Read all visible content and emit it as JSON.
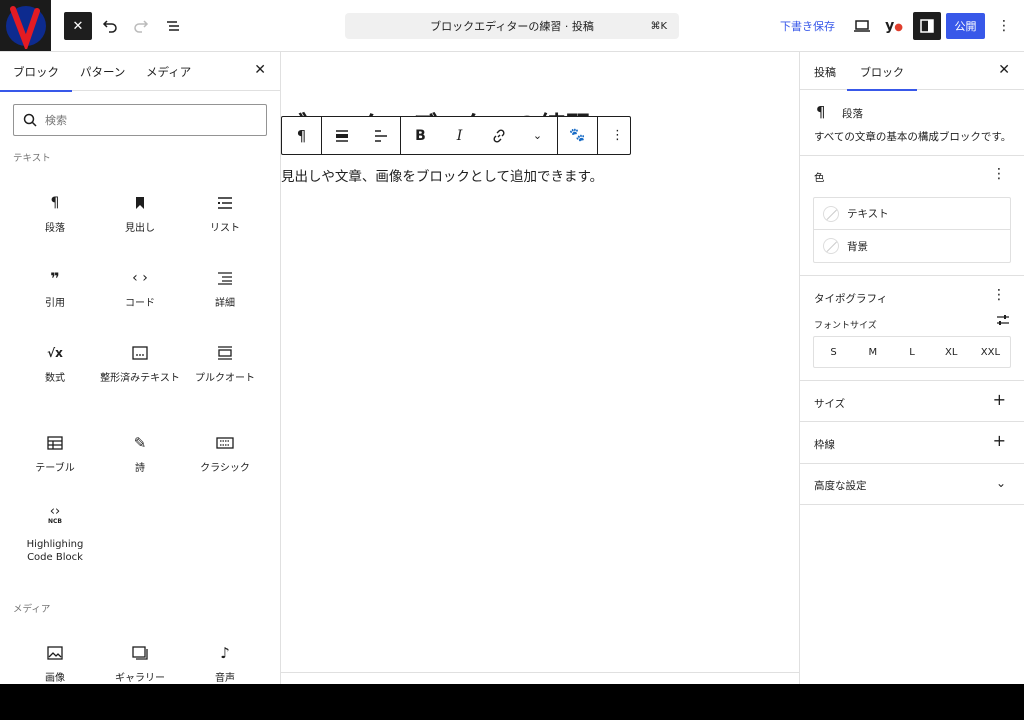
{
  "header": {
    "command_title": "ブロックエディターの練習 · 投稿",
    "command_shortcut": "⌘K",
    "save_draft": "下書き保存",
    "publish": "公開",
    "accent_color": "#3858e9"
  },
  "inserter": {
    "tabs": [
      {
        "label": "ブロック",
        "active": true
      },
      {
        "label": "パターン",
        "active": false
      },
      {
        "label": "メディア",
        "active": false
      }
    ],
    "search_placeholder": "検索",
    "categories": [
      {
        "name": "テキスト",
        "blocks": [
          {
            "label": "段落",
            "icon": "paragraph-icon"
          },
          {
            "label": "見出し",
            "icon": "heading-icon"
          },
          {
            "label": "リスト",
            "icon": "list-icon"
          },
          {
            "label": "引用",
            "icon": "quote-icon"
          },
          {
            "label": "コード",
            "icon": "code-icon"
          },
          {
            "label": "詳細",
            "icon": "details-icon"
          },
          {
            "label": "数式",
            "icon": "math-icon"
          },
          {
            "label": "整形済みテキスト",
            "icon": "preformatted-icon"
          },
          {
            "label": "プルクオート",
            "icon": "pullquote-icon"
          },
          {
            "label": "テーブル",
            "icon": "table-icon"
          },
          {
            "label": "詩",
            "icon": "verse-icon"
          },
          {
            "label": "クラシック",
            "icon": "classic-icon"
          },
          {
            "label": "Highlighing Code Block",
            "icon": "ncb-code-icon"
          }
        ]
      },
      {
        "name": "メディア",
        "blocks": [
          {
            "label": "画像",
            "icon": "image-icon"
          },
          {
            "label": "ギャラリー",
            "icon": "gallery-icon"
          },
          {
            "label": "音声",
            "icon": "audio-icon"
          }
        ]
      }
    ]
  },
  "canvas": {
    "title": "ブロックエディターの練習",
    "paragraph": "見出しや文章、画像をブロックとして追加できます。"
  },
  "settings": {
    "tabs": [
      {
        "label": "投稿",
        "active": false
      },
      {
        "label": "ブロック",
        "active": true
      }
    ],
    "block_name": "段落",
    "block_description": "すべての文章の基本の構成ブロックです。",
    "color_panel": {
      "title": "色",
      "items": [
        "テキスト",
        "背景"
      ]
    },
    "typography_panel": {
      "title": "タイポグラフィ",
      "font_size_label": "フォントサイズ",
      "sizes": [
        "S",
        "M",
        "L",
        "XL",
        "XXL"
      ]
    },
    "size_panel": "サイズ",
    "border_panel": "枠線",
    "advanced_panel": "高度な設定"
  }
}
